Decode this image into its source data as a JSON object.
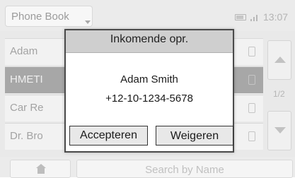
{
  "status_bar": {
    "phone_book_label": "Phone Book",
    "clock": "13:07",
    "battery_icon": "battery-icon",
    "signal_icon": "signal-icon"
  },
  "contacts": [
    {
      "name": "Adam"
    },
    {
      "name": "HMETI"
    },
    {
      "name": "Car Re"
    },
    {
      "name": "Dr. Bro"
    }
  ],
  "scroll": {
    "page_indicator": "1/2",
    "up_icon": "arrow-up-icon",
    "down_icon": "arrow-down-icon"
  },
  "bottom_bar": {
    "home_icon": "home-icon",
    "search_label": "Search by Name"
  },
  "dialog": {
    "title": "Inkomende opr.",
    "caller_name": "Adam Smith",
    "caller_number": "+12-10-1234-5678",
    "accept_label": "Accepteren",
    "decline_label": "Weigeren"
  },
  "colors": {
    "dialog_border": "#4a4a4a",
    "dialog_header": "#cfcfcf",
    "selected_row": "#a7a7a7",
    "background": "#e9e9e9"
  }
}
